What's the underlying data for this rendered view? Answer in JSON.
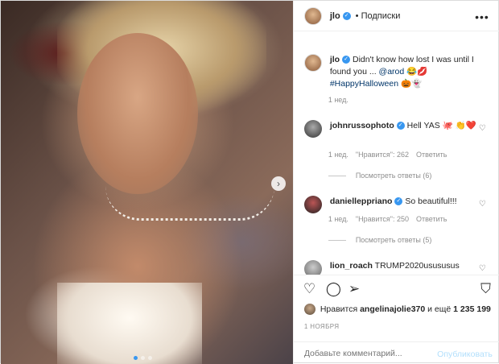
{
  "header": {
    "username": "jlo",
    "separator": "•",
    "follow_label": "Подписки",
    "more": "•••"
  },
  "caption": {
    "username": "jlo",
    "text": "Didn't know how lost I was until I found you ...",
    "mention": "@arod",
    "emoji1": "😂💋",
    "hashtag": "#HappyHalloween",
    "emoji2": "🎃👻",
    "time": "1 нед."
  },
  "comments": [
    {
      "username": "johnrussophoto",
      "text": "Hell YAS 🐙 👏❤️",
      "time": "1 нед.",
      "likes": "\"Нравится\": 262",
      "reply": "Ответить",
      "view_replies": "Посмотреть ответы (6)"
    },
    {
      "username": "danielleppriano",
      "text": "So beautiful!!!",
      "time": "1 нед.",
      "likes": "\"Нравится\": 250",
      "reply": "Ответить",
      "view_replies": "Посмотреть ответы (5)"
    },
    {
      "username": "lion_roach",
      "text": "TRUMP2020usususus"
    }
  ],
  "likes": {
    "prefix": "Нравится",
    "user": "angelinajolie370",
    "middle": "и ещё",
    "count": "1 235 199"
  },
  "date": "1 НОЯБРЯ",
  "add_comment": {
    "placeholder": "Добавьте комментарий...",
    "publish": "Опубликовать"
  },
  "colors": {
    "accent": "#3897f0",
    "publish": "#b2dffc"
  }
}
